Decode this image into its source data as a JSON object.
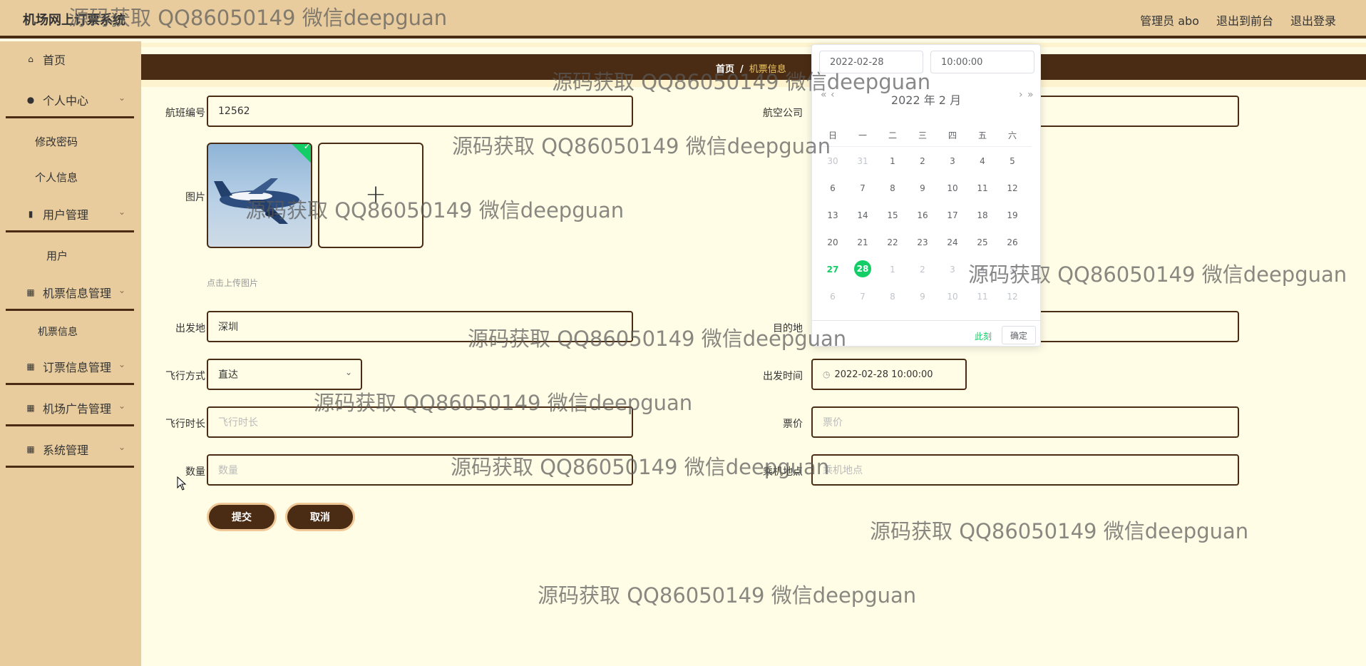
{
  "app": {
    "title": "机场网上订票系统"
  },
  "header": {
    "user": "管理员 abo",
    "front": "退出到前台",
    "logout": "退出登录"
  },
  "sidebar": {
    "home": "首页",
    "personal_center": "个人中心",
    "change_password": "修改密码",
    "personal_info": "个人信息",
    "user_mgmt": "用户管理",
    "user": "用户",
    "ticket_mgmt": "机票信息管理",
    "ticket_info": "机票信息",
    "order_mgmt": "订票信息管理",
    "ad_mgmt": "机场广告管理",
    "sys_mgmt": "系统管理"
  },
  "breadcrumb": {
    "home": "首页",
    "sep": "/",
    "current": "机票信息"
  },
  "form": {
    "flight_no_label": "航班编号",
    "flight_no": "12562",
    "airline_label": "航空公司",
    "image_label": "图片",
    "upload_hint": "点击上传图片",
    "plus": "+",
    "departure_label": "出发地",
    "departure": "深圳",
    "destination_label": "目的地",
    "mode_label": "飞行方式",
    "mode": "直达",
    "depart_time_label": "出发时间",
    "depart_time": "2022-02-28 10:00:00",
    "duration_label": "飞行时长",
    "duration_placeholder": "飞行时长",
    "price_label": "票价",
    "price_placeholder": "票价",
    "qty_label": "数量",
    "qty_placeholder": "数量",
    "boarding_label": "乘机地点",
    "boarding_placeholder": "乘机地点",
    "submit": "提交",
    "cancel": "取消"
  },
  "picker": {
    "date": "2022-02-28",
    "time": "10:00:00",
    "header": "2022 年  2 月",
    "prev_year": "«",
    "prev_month": "‹",
    "next_month": "›",
    "next_year": "»",
    "weekdays": [
      "日",
      "一",
      "二",
      "三",
      "四",
      "五",
      "六"
    ],
    "rows": [
      [
        "30",
        "31",
        "1",
        "2",
        "3",
        "4",
        "5"
      ],
      [
        "6",
        "7",
        "8",
        "9",
        "10",
        "11",
        "12"
      ],
      [
        "13",
        "14",
        "15",
        "16",
        "17",
        "18",
        "19"
      ],
      [
        "20",
        "21",
        "22",
        "23",
        "24",
        "25",
        "26"
      ],
      [
        "27",
        "28",
        "1",
        "2",
        "3",
        "4",
        "5"
      ],
      [
        "6",
        "7",
        "8",
        "9",
        "10",
        "11",
        "12"
      ]
    ],
    "now": "此刻",
    "ok": "确定"
  },
  "watermark": "源码获取 QQ86050149 微信deepguan"
}
